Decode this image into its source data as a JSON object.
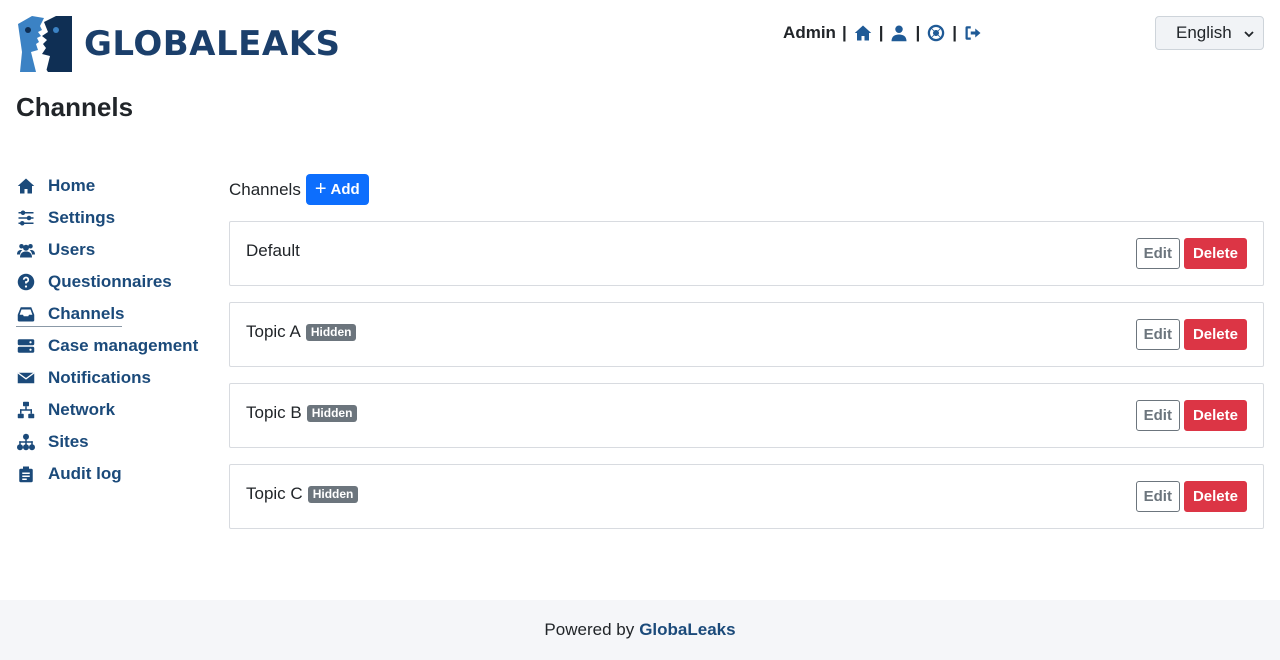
{
  "brand": {
    "logo_text": "GLOBALEAKS",
    "primary_color": "#1b4a7a"
  },
  "header": {
    "user": "Admin",
    "icons": [
      "home-icon",
      "user-icon",
      "support-icon",
      "logout-icon"
    ],
    "language": "English"
  },
  "page_title": "Channels",
  "sidebar": {
    "items": [
      {
        "label": "Home",
        "icon": "home-icon"
      },
      {
        "label": "Settings",
        "icon": "sliders-icon"
      },
      {
        "label": "Users",
        "icon": "users-icon"
      },
      {
        "label": "Questionnaires",
        "icon": "question-icon"
      },
      {
        "label": "Channels",
        "icon": "inbox-icon",
        "active": true
      },
      {
        "label": "Case management",
        "icon": "server-icon"
      },
      {
        "label": "Notifications",
        "icon": "envelope-icon"
      },
      {
        "label": "Network",
        "icon": "network-icon"
      },
      {
        "label": "Sites",
        "icon": "sitemap-icon"
      },
      {
        "label": "Audit log",
        "icon": "clipboard-icon"
      }
    ]
  },
  "main": {
    "heading": "Channels",
    "add_label": "Add",
    "edit_label": "Edit",
    "delete_label": "Delete",
    "channels": [
      {
        "name": "Default",
        "badge": ""
      },
      {
        "name": "Topic A",
        "badge": "Hidden"
      },
      {
        "name": "Topic B",
        "badge": "Hidden"
      },
      {
        "name": "Topic C",
        "badge": "Hidden"
      }
    ]
  },
  "footer": {
    "prefix": "Powered by",
    "brand": "GlobaLeaks"
  }
}
